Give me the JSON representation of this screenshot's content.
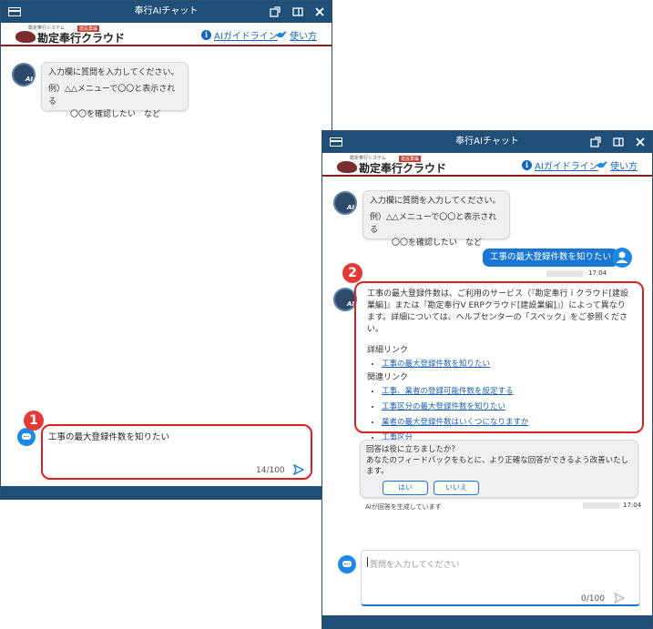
{
  "window": {
    "title": "奉行AIチャット",
    "header": {
      "logo_small": "勘定奉行システム",
      "logo_main": "勘定奉行クラウド",
      "logo_badge": "建設業編",
      "guideline_link": "AIガイドライン",
      "howto_link": "使い方"
    },
    "greeting": {
      "line1": "入力欄に質問を入力してください。",
      "line2": "例）△△メニューで〇〇と表示される",
      "line3": "〇〇を確認したい　など"
    },
    "input_placeholder": "質問を入力してください",
    "avatar_label": "AI"
  },
  "left": {
    "input_value": "工事の最大登録件数を知りたい",
    "counter": "14/100",
    "callout_number": "1"
  },
  "right": {
    "user_message": "工事の最大登録件数を知りたい",
    "user_time": "17:04",
    "answer_text": "工事の最大登録件数は、ご利用のサービス（『勘定奉行ｉクラウド[建設業編]』または『勘定奉行V ERPクラウド[建設業編]』）によって異なります。詳細については、ヘルプセンターの「スペック」をご参照ください。",
    "detail_heading": "詳細リンク",
    "detail_links": [
      "工事の最大登録件数を知りたい"
    ],
    "related_heading": "関連リンク",
    "related_links": [
      "工事、業者の登録可能件数を設定する",
      "工事区分の最大登録件数を知りたい",
      "業者の最大登録件数はいくつになりますか",
      "工事区分"
    ],
    "feedback_q1": "回答は役に立ちましたか？",
    "feedback_q2": "あなたのフィードバックをもとに、より正確な回答ができるよう改善いたします。",
    "yes_label": "はい",
    "no_label": "いいえ",
    "answer_time": "17:04",
    "generated_note": "AIが回答を生成しています",
    "counter": "0/100",
    "callout_number": "2"
  },
  "colors": {
    "titlebar": "#1f4e79",
    "accent_red": "#8b1e1e",
    "callout_red": "#e02020",
    "user_bubble": "#1976d2"
  }
}
